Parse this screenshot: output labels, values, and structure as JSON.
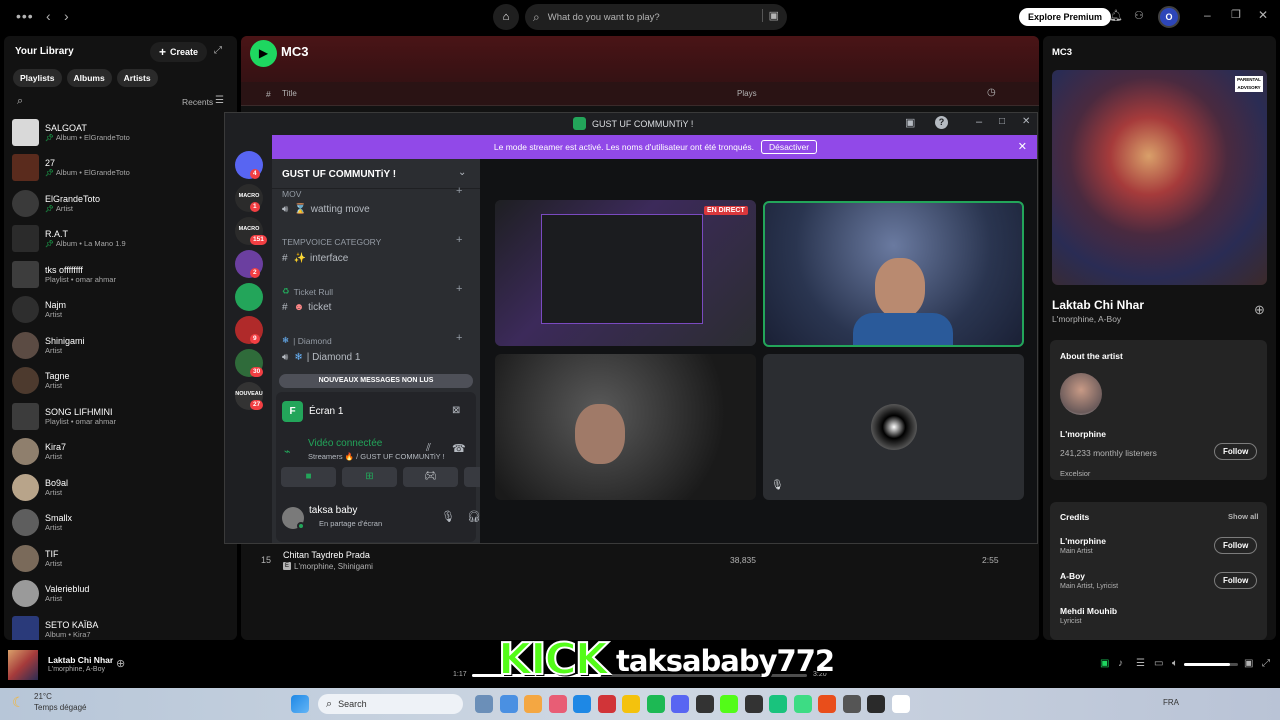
{
  "topbar": {
    "search_placeholder": "What do you want to play?",
    "explore_label": "Explore Premium",
    "avatar_letter": "O"
  },
  "library": {
    "title": "Your Library",
    "create_label": "Create",
    "filters": [
      "Playlists",
      "Albums",
      "Artists"
    ],
    "sort_label": "Recents",
    "items": [
      {
        "title": "SALGOAT",
        "sub": "Album • ElGrandeToto",
        "pinned": true,
        "round": false,
        "color": "#d9d9d9"
      },
      {
        "title": "27",
        "sub": "Album • ElGrandeToto",
        "pinned": true,
        "round": false,
        "color": "#5a2b1d"
      },
      {
        "title": "ElGrandeToto",
        "sub": "Artist",
        "pinned": true,
        "round": true,
        "color": "#3a3a3a"
      },
      {
        "title": "R.A.T",
        "sub": "Album • La Mano 1.9",
        "pinned": true,
        "round": false,
        "color": "#2b2b2b"
      },
      {
        "title": "tks offffffff",
        "sub": "Playlist • omar ahmar",
        "pinned": false,
        "round": false,
        "color": "#3d3d3d"
      },
      {
        "title": "Najm",
        "sub": "Artist",
        "pinned": false,
        "round": true,
        "color": "#2e2e2e"
      },
      {
        "title": "Shinigami",
        "sub": "Artist",
        "pinned": false,
        "round": true,
        "color": "#5b4b43"
      },
      {
        "title": "Tagne",
        "sub": "Artist",
        "pinned": false,
        "round": true,
        "color": "#4d3a2e"
      },
      {
        "title": "SONG LIFHMINI",
        "sub": "Playlist • omar ahmar",
        "pinned": false,
        "round": false,
        "color": "#3c3c3c"
      },
      {
        "title": "Kira7",
        "sub": "Artist",
        "pinned": false,
        "round": true,
        "color": "#8f7f6d"
      },
      {
        "title": "Bo9al",
        "sub": "Artist",
        "pinned": false,
        "round": true,
        "color": "#b8a48a"
      },
      {
        "title": "Smallx",
        "sub": "Artist",
        "pinned": false,
        "round": true,
        "color": "#5e5e5e"
      },
      {
        "title": "TIF",
        "sub": "Artist",
        "pinned": false,
        "round": true,
        "color": "#7a6a5a"
      },
      {
        "title": "Valerieblud",
        "sub": "Artist",
        "pinned": false,
        "round": true,
        "color": "#9a9a9a"
      },
      {
        "title": "SETO KAÏBA",
        "sub": "Album • Kira7",
        "pinned": false,
        "round": false,
        "color": "#2a3a7a"
      }
    ]
  },
  "main": {
    "playlist_title": "MC3",
    "columns": {
      "num": "#",
      "title": "Title",
      "plays": "Plays"
    },
    "track": {
      "num": "15",
      "title": "Chitan Taydreb Prada",
      "artists": "L'morphine, Shinigami",
      "explicit": "E",
      "plays": "38,835",
      "duration": "2:55"
    }
  },
  "rpanel": {
    "header": "MC3",
    "song_title": "Laktab Chi Nhar",
    "song_artists": "L'morphine, A-Boy",
    "about_title": "About the artist",
    "artist_name": "L'morphine",
    "listeners": "241,233 monthly listeners",
    "artist_desc": "Excelsior",
    "follow_label": "Follow",
    "credits_title": "Credits",
    "show_all": "Show all",
    "credits": [
      {
        "name": "L'morphine",
        "role": "Main Artist",
        "follow": true
      },
      {
        "name": "A-Boy",
        "role": "Main Artist, Lyricist",
        "follow": true
      },
      {
        "name": "Mehdi Mouhib",
        "role": "Lyricist",
        "follow": false
      }
    ]
  },
  "discord": {
    "window_title": "GUST UF COMMUNTiY !",
    "banner_text": "Le mode streamer est activé. Les noms d'utilisateur ont été tronqués.",
    "banner_button": "Désactiver",
    "server_name": "GUST UF COMMUNTiY !",
    "servers": [
      {
        "label": "",
        "badge": "4",
        "color": "#5865f2"
      },
      {
        "label": "MACRO",
        "badge": "1",
        "color": "#2b2b2b"
      },
      {
        "label": "MACRO",
        "badge": "151",
        "color": "#2b2b2b"
      },
      {
        "label": "",
        "badge": "2",
        "color": "#6b3fa0"
      },
      {
        "label": "",
        "badge": "",
        "color": "#23a55a"
      },
      {
        "label": "",
        "badge": "9",
        "color": "#b02a2a"
      },
      {
        "label": "",
        "badge": "30",
        "color": "#2f6b3a"
      },
      {
        "label": "NOUVEAU",
        "badge": "27",
        "color": "#333"
      }
    ],
    "channels": {
      "cat_mov": "MOV",
      "ch_watting": "watting move",
      "cat_tempvoice": "TEMPVOICE CATEGORY",
      "ch_interface": "interface",
      "cat_ticket": "Ticket Rull",
      "ch_ticket": "ticket",
      "cat_diamond": "| Diamond",
      "ch_diamond": "| Diamond 1",
      "new_messages": "NOUVEAUX MESSAGES NON LUS"
    },
    "screen_label": "Écran 1",
    "voice_status": "Vidéo connectée",
    "voice_channel": "Streamers 🔥 / GUST UF COMMUNTiY !",
    "username": "taksa baby",
    "user_status": "En partage d'écran",
    "live_label": "EN DIRECT"
  },
  "player": {
    "now_title": "Laktab Chi Nhar",
    "now_artists": "L'morphine, A-Boy",
    "elapsed": "1:17",
    "total": "3:20",
    "progress": 0.385,
    "volume": 0.85
  },
  "overlay": {
    "kick_logo": "KICK",
    "kick_user": "taksababy772"
  },
  "taskbar": {
    "weather_temp": "21°C",
    "weather_desc": "Temps dégagé",
    "search_label": "Search",
    "lang": "FRA"
  }
}
